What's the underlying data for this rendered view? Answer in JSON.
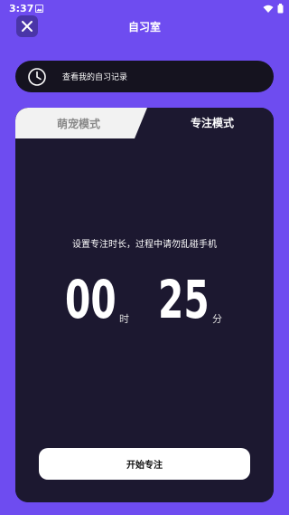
{
  "status_bar": {
    "time": "3:37"
  },
  "header": {
    "title": "自习室"
  },
  "record": {
    "label": "查看我的自习记录"
  },
  "tabs": [
    {
      "label": "萌宠模式",
      "active": false
    },
    {
      "label": "专注模式",
      "active": true
    }
  ],
  "focus": {
    "instruction": "设置专注时长，过程中请勿乱碰手机",
    "hours": "00",
    "hours_unit": "时",
    "minutes": "25",
    "minutes_unit": "分",
    "start_label": "开始专注"
  },
  "colors": {
    "background": "#6e4cf0",
    "card": "#1c1830",
    "accent_dark": "#15131f"
  },
  "icons": [
    "image-icon",
    "wifi-icon",
    "battery-icon",
    "close-icon",
    "clock-icon"
  ]
}
